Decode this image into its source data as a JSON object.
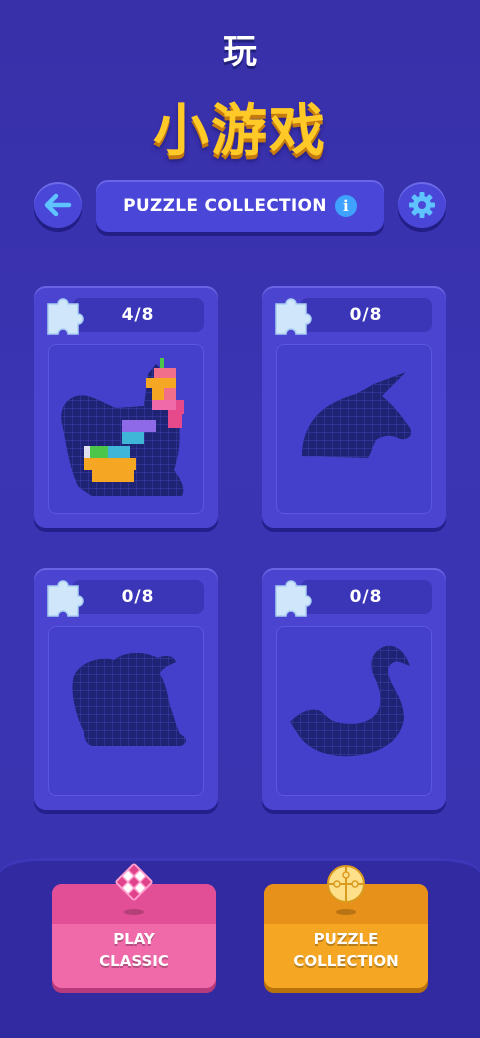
{
  "header": {
    "title_small": "玩",
    "title_big": "小游戏",
    "label": "PUZZLE COLLECTION",
    "info_glyph": "i",
    "back_icon": "arrow-left-icon",
    "settings_icon": "gear-icon"
  },
  "puzzles": [
    {
      "shape": "cat",
      "progress": "4/8"
    },
    {
      "shape": "unicorn",
      "progress": "0/8"
    },
    {
      "shape": "rabbit",
      "progress": "0/8"
    },
    {
      "shape": "swan",
      "progress": "0/8"
    }
  ],
  "buttons": {
    "play_line1": "PLAY",
    "play_line2": "CLASSIC",
    "coll_line1": "PUZZLE",
    "coll_line2": "COLLECTION"
  },
  "colors": {
    "background": "#3a33b0",
    "accent_gold": "#ffc928",
    "play_pink": "#f06aaa",
    "collection_orange": "#f5a623",
    "info_blue": "#3fa2ff"
  }
}
